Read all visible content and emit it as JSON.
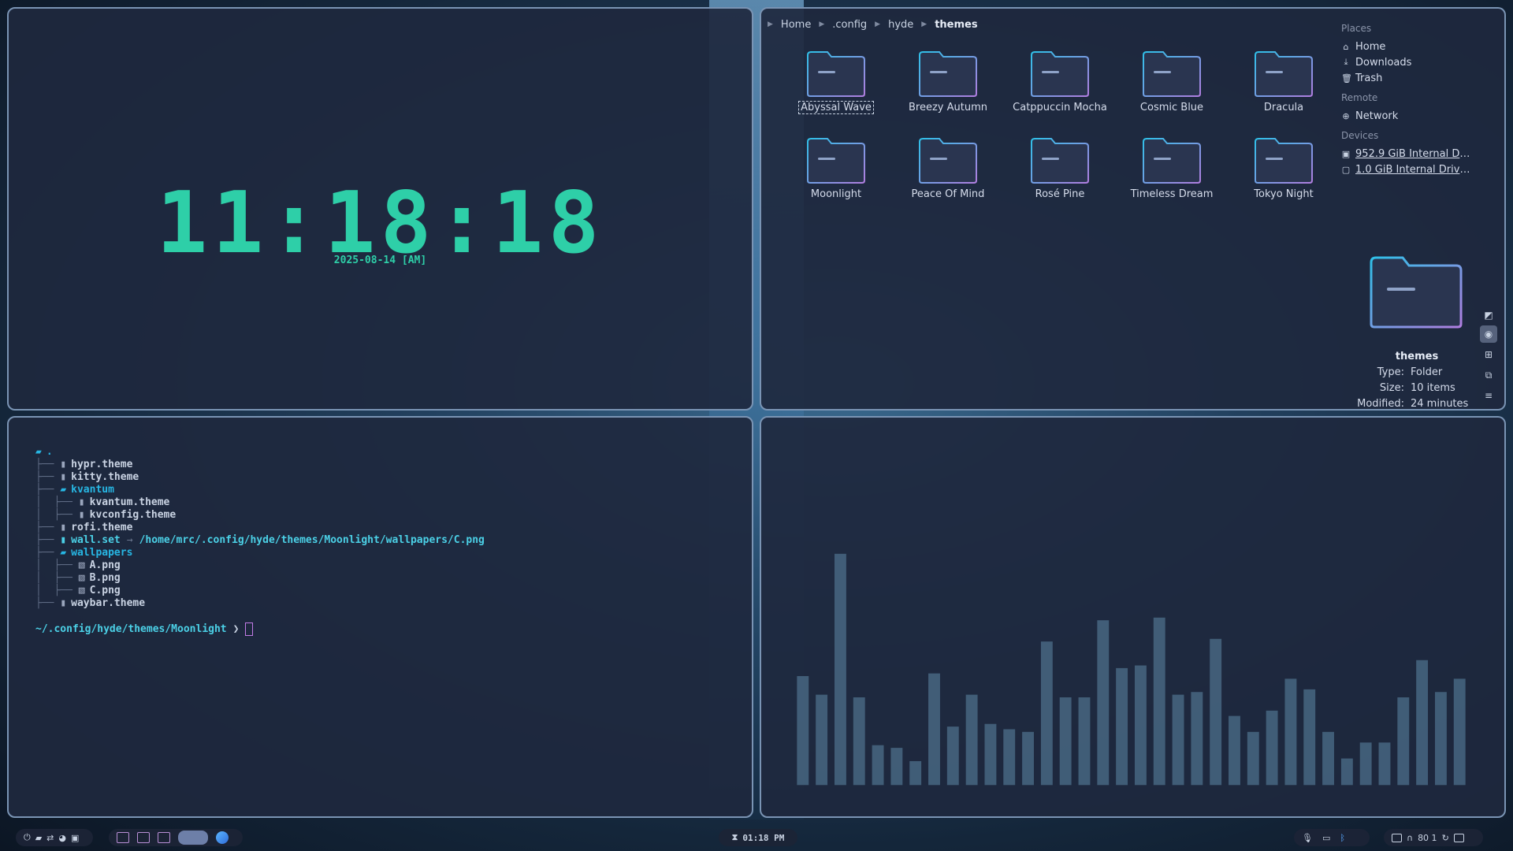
{
  "clock": {
    "time": "11:18:18",
    "date": "2025-08-14 [AM]"
  },
  "files": {
    "breadcrumbs": [
      "Home",
      ".config",
      "hyde",
      "themes"
    ],
    "folders": [
      "Abyssal Wave",
      "Breezy Autumn",
      "Catppuccin Mocha",
      "Cosmic Blue",
      "Dracula",
      "Moonlight",
      "Peace Of Mind",
      "Rosé Pine",
      "Timeless Dream",
      "Tokyo Night"
    ],
    "selected_folder": "Abyssal Wave",
    "places_heading": "Places",
    "places": [
      {
        "label": "Home",
        "icon": "home-icon"
      },
      {
        "label": "Downloads",
        "icon": "download-icon"
      },
      {
        "label": "Trash",
        "icon": "trash-icon"
      }
    ],
    "remote_heading": "Remote",
    "remote": [
      {
        "label": "Network",
        "icon": "network-icon"
      }
    ],
    "devices_heading": "Devices",
    "devices": [
      {
        "label": "952.9 GiB Internal Driv...",
        "icon": "drive-icon"
      },
      {
        "label": "1.0 GiB Internal Drive (...",
        "icon": "drive-icon"
      }
    ],
    "preview": {
      "name": "themes",
      "type_label": "Type:",
      "type_value": "Folder",
      "size_label": "Size:",
      "size_value": "10 items",
      "modified_label": "Modified:",
      "modified_value": "24 minutes"
    }
  },
  "terminal": {
    "root": ".",
    "entries": [
      {
        "depth": 1,
        "kind": "file",
        "name": "hypr.theme"
      },
      {
        "depth": 1,
        "kind": "file",
        "name": "kitty.theme"
      },
      {
        "depth": 1,
        "kind": "dir",
        "name": "kvantum"
      },
      {
        "depth": 2,
        "kind": "file",
        "name": "kvantum.theme"
      },
      {
        "depth": 2,
        "kind": "file",
        "name": "kvconfig.theme"
      },
      {
        "depth": 1,
        "kind": "file",
        "name": "rofi.theme"
      },
      {
        "depth": 1,
        "kind": "link",
        "name": "wall.set",
        "target": "/home/mrc/.config/hyde/themes/Moonlight/wallpapers/C.png"
      },
      {
        "depth": 1,
        "kind": "dir",
        "name": "wallpapers"
      },
      {
        "depth": 2,
        "kind": "img",
        "name": "A.png"
      },
      {
        "depth": 2,
        "kind": "img",
        "name": "B.png"
      },
      {
        "depth": 2,
        "kind": "img",
        "name": "C.png"
      },
      {
        "depth": 1,
        "kind": "file",
        "name": "waybar.theme"
      }
    ],
    "prompt_path": "~/.config/hyde/themes/Moonlight",
    "prompt_symbol": "❯"
  },
  "visualizer": {
    "bar_color": "#4a6a86",
    "levels": [
      0.41,
      0.34,
      0.87,
      0.33,
      0.15,
      0.14,
      0.09,
      0.42,
      0.22,
      0.34,
      0.23,
      0.21,
      0.2,
      0.54,
      0.33,
      0.33,
      0.62,
      0.44,
      0.45,
      0.63,
      0.34,
      0.35,
      0.55,
      0.26,
      0.2,
      0.28,
      0.4,
      0.36,
      0.2,
      0.1,
      0.16,
      0.16,
      0.33,
      0.47,
      0.35,
      0.4
    ]
  },
  "taskbar": {
    "clock": "01:18 PM",
    "tray_text": "80  1"
  }
}
